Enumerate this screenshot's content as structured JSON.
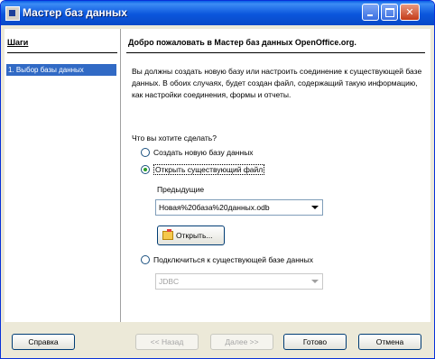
{
  "window": {
    "title": "Мастер баз данных",
    "icon": "database-icon"
  },
  "sidebar": {
    "title": "Шаги",
    "items": [
      {
        "label": "1. Выбор базы данных",
        "selected": true
      }
    ]
  },
  "content": {
    "heading": "Добро пожаловать в Мастер баз данных OpenOffice.org.",
    "description": "Вы должны создать новую базу или настроить соединение к существующей базе данных. В обоих случаях, будет создан файл, содержащий такую информацию, как настройки соединения, формы и отчеты.",
    "question": "Что вы хотите сделать?",
    "options": [
      {
        "label": "Создать новую базу данных",
        "checked": false
      },
      {
        "label": "Открыть существующий файл",
        "checked": true
      },
      {
        "label": "Подключиться к существующей базе данных",
        "checked": false
      }
    ],
    "previous_label": "Предыдущие",
    "previous_value": "Новая%20база%20данных.odb",
    "open_button": "Открыть...",
    "connection_value": "JDBC"
  },
  "footer": {
    "help": "Справка",
    "back": "<< Назад",
    "next": "Далее >>",
    "finish": "Готово",
    "cancel": "Отмена"
  },
  "colors": {
    "titlebar": "#0b56dc",
    "selection": "#316ac5",
    "dialog_bg": "#ece9d8"
  }
}
